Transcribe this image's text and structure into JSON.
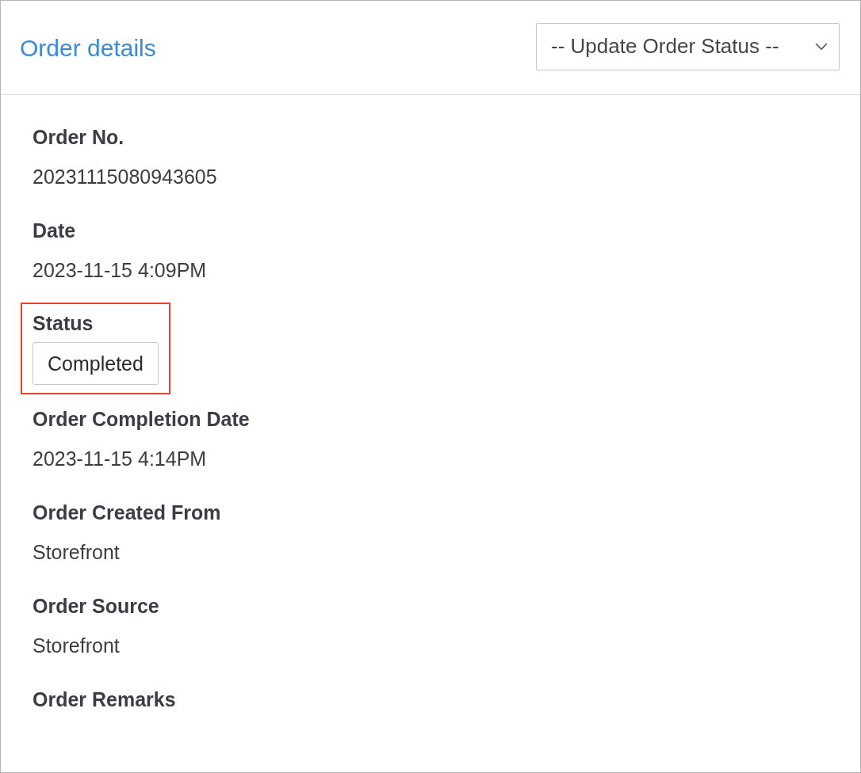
{
  "header": {
    "title": "Order details",
    "status_select": {
      "value": "-- Update Order Status --"
    }
  },
  "fields": [
    {
      "kind": "text",
      "label": "Order No.",
      "value": "20231115080943605",
      "highlighted": false
    },
    {
      "kind": "text",
      "label": "Date",
      "value": "2023-11-15 4:09PM",
      "highlighted": false
    },
    {
      "kind": "badge",
      "label": "Status",
      "value": "Completed",
      "highlighted": true
    },
    {
      "kind": "text",
      "label": "Order Completion Date",
      "value": "2023-11-15 4:14PM",
      "highlighted": false
    },
    {
      "kind": "text",
      "label": "Order Created From",
      "value": "Storefront",
      "highlighted": false
    },
    {
      "kind": "text",
      "label": "Order Source",
      "value": "Storefront",
      "highlighted": false
    },
    {
      "kind": "text",
      "label": "Order Remarks",
      "highlighted": false
    }
  ]
}
